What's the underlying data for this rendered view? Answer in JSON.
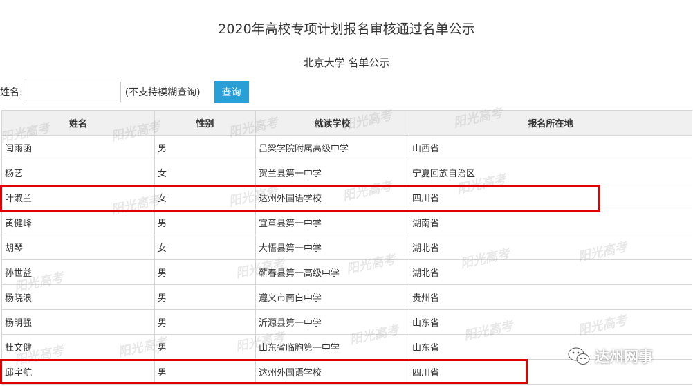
{
  "title": "2020年高校专项计划报名审核通过名单公示",
  "subtitle": "北京大学 名单公示",
  "search": {
    "label": "姓名:",
    "value": "",
    "placeholder": "",
    "hint": "(不支持模糊查询)",
    "button": "查询"
  },
  "table": {
    "headers": [
      "姓名",
      "性别",
      "就读学校",
      "报名所在地"
    ],
    "rows": [
      [
        "闫雨函",
        "男",
        "吕梁学院附属高级中学",
        "山西省"
      ],
      [
        "杨艺",
        "女",
        "贺兰县第一中学",
        "宁夏回族自治区"
      ],
      [
        "叶淑兰",
        "女",
        "达州外国语学校",
        "四川省"
      ],
      [
        "黄健峰",
        "男",
        "宜章县第一中学",
        "湖南省"
      ],
      [
        "胡琴",
        "女",
        "大悟县第一中学",
        "湖北省"
      ],
      [
        "孙世益",
        "男",
        "蕲春县第一高级中学",
        "湖北省"
      ],
      [
        "杨晓浪",
        "男",
        "遵义市南白中学",
        "贵州省"
      ],
      [
        "杨明强",
        "男",
        "沂源县第一中学",
        "山东省"
      ],
      [
        "杜文健",
        "男",
        "山东省临朐第一中学",
        "山东省"
      ],
      [
        "邱宇航",
        "男",
        "达州外国语学校",
        "四川省"
      ]
    ]
  },
  "watermark": "阳光高考",
  "logo": {
    "text": "达州网事",
    "icon": "wechat-icon"
  },
  "colors": {
    "button": "#2a9fd6",
    "highlight": "#e00000",
    "header_bg": "#f0f0f0"
  }
}
